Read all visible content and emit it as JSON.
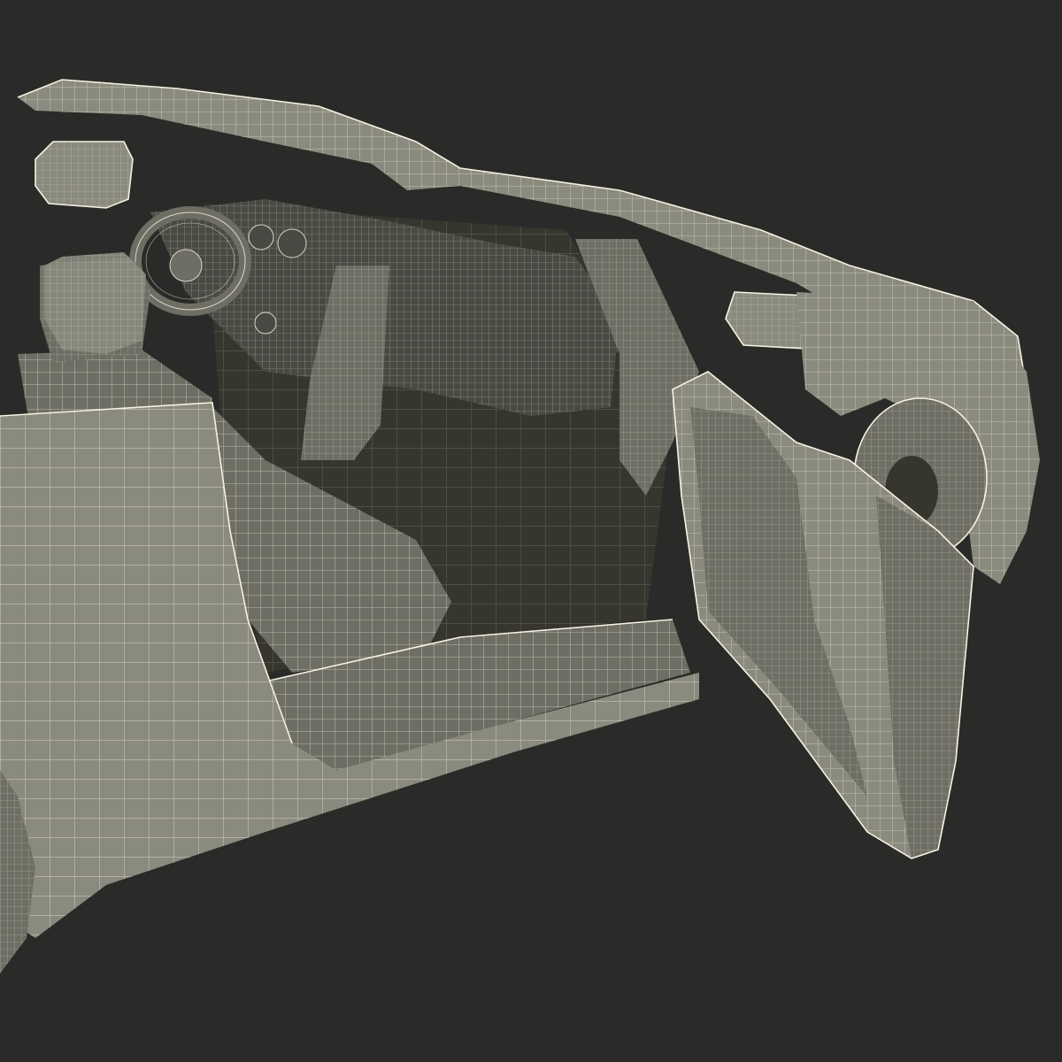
{
  "scene": {
    "subject": "wireframe-render",
    "colors": {
      "background": "#2a2a28",
      "surface_light": "#8a8a7e",
      "surface_mid": "#6e6e64",
      "surface_dark": "#4a4a44",
      "wireframe": "#f0ecdc"
    }
  }
}
